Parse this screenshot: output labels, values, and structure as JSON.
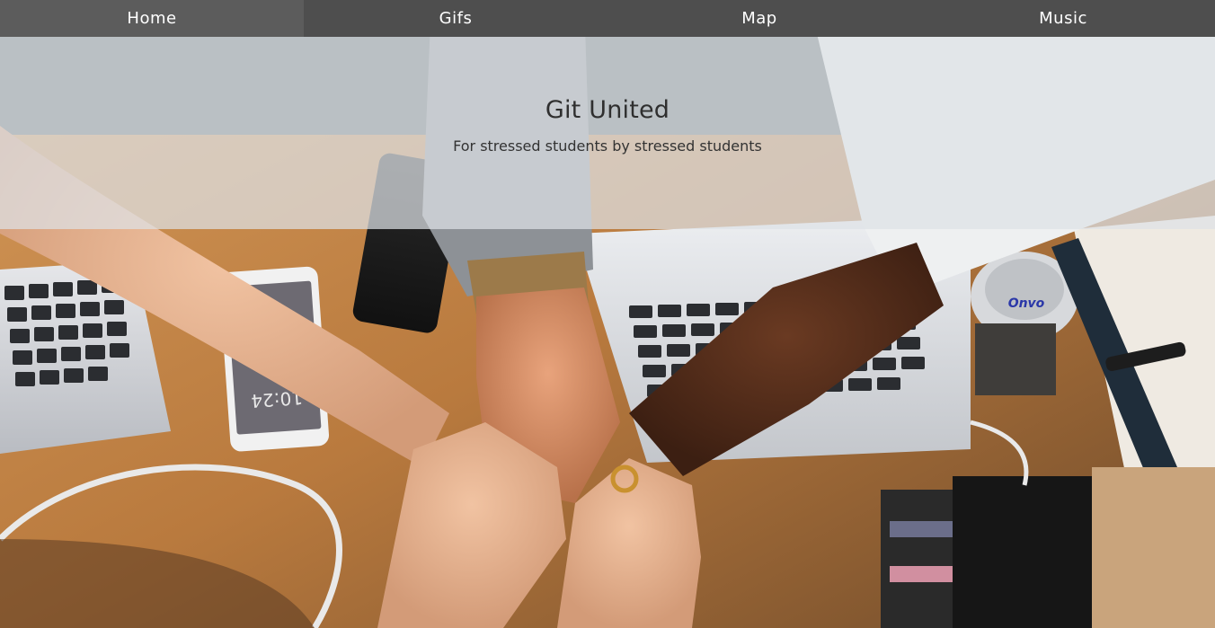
{
  "nav": {
    "items": [
      {
        "label": "Home"
      },
      {
        "label": "Gifs"
      },
      {
        "label": "Map"
      },
      {
        "label": "Music"
      }
    ]
  },
  "hero": {
    "title": "Git United",
    "subtitle": "For stressed students by stressed students"
  },
  "background": {
    "phone_time": "10:24",
    "cup_text": "Onvo"
  },
  "colors": {
    "nav_bg": "#4e4e4e",
    "hero_overlay": "#dee2e6",
    "table_wood": "#c98a4b"
  }
}
